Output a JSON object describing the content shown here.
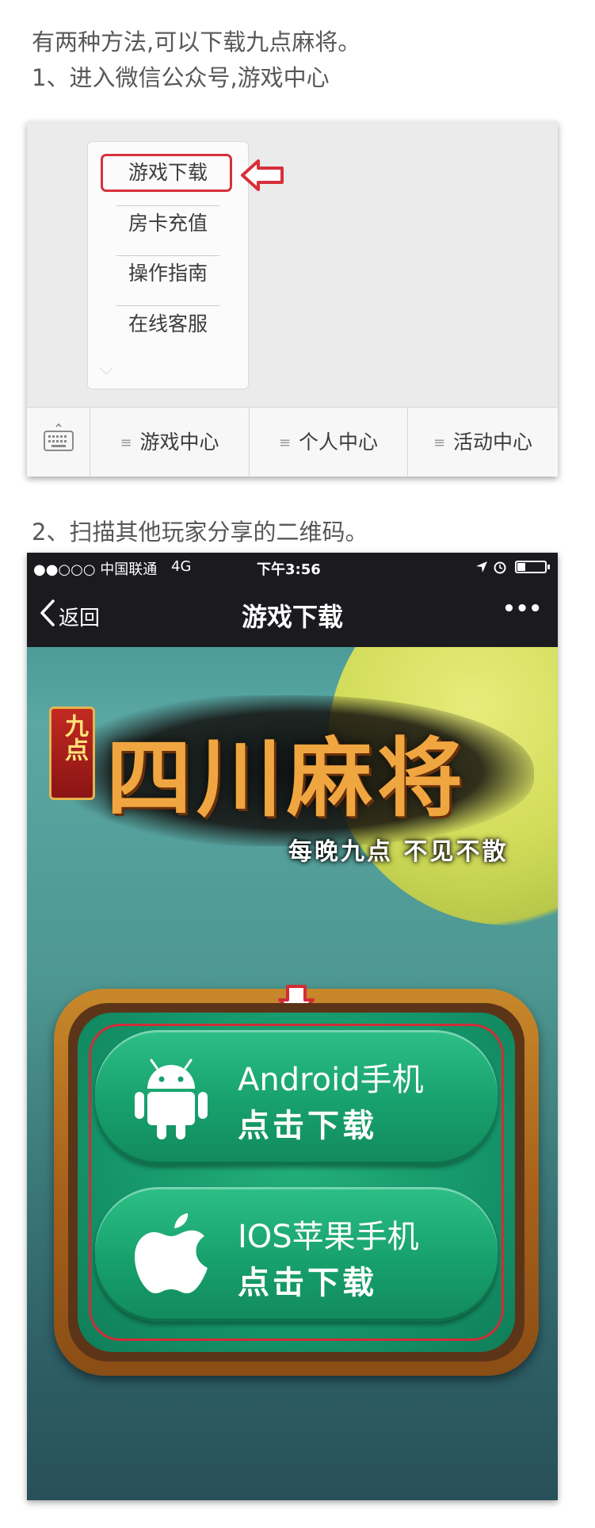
{
  "intro": {
    "line1": "有两种方法,可以下载九点麻将。",
    "line2": "1、进入微信公众号,游戏中心"
  },
  "wechat_menu": {
    "popup_items": [
      {
        "label": "游戏下载"
      },
      {
        "label": "房卡充值"
      },
      {
        "label": "操作指南"
      },
      {
        "label": "在线客服"
      }
    ],
    "menu_bar": [
      {
        "label": "游戏中心"
      },
      {
        "label": "个人中心"
      },
      {
        "label": "活动中心"
      }
    ],
    "highlight_color": "#d7303a"
  },
  "step2": "2、扫描其他玩家分享的二维码。",
  "phone": {
    "status": {
      "carrier": "●●○○○ 中国联通",
      "network": "4G",
      "time": "下午3:56"
    },
    "nav": {
      "back_label": "返回",
      "title": "游戏下载",
      "more": "•••"
    },
    "game": {
      "badge": "九点",
      "logo_title": "四川麻将",
      "tagline": "每晚九点  不见不散"
    },
    "downloads": [
      {
        "title": "Android手机",
        "action": "点击下载",
        "icon": "android-icon"
      },
      {
        "title": "IOS苹果手机",
        "action": "点击下载",
        "icon": "apple-icon"
      }
    ]
  }
}
